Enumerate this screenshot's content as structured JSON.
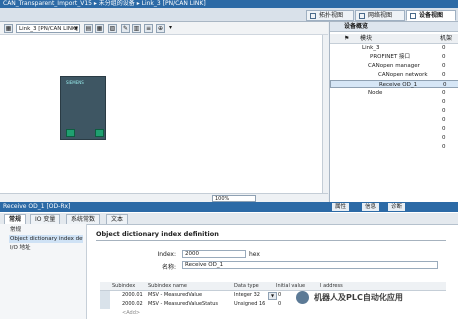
{
  "window": {
    "title": "CAN_Transparent_Import_V15 ▸ 未分组的设备 ▸ Link_3 [PN/CAN LINK]"
  },
  "view_tabs": [
    "拓扑视图",
    "网络视图",
    "设备视图"
  ],
  "toolbar": {
    "device_select": "Link_3 [PN/CAN LINK]"
  },
  "device": {
    "brand": "SIEMENS"
  },
  "zoom": {
    "value": "100%"
  },
  "overview": {
    "title": "设备概览",
    "col_module": "模块",
    "col_rack": "机架",
    "rows": [
      {
        "name": "Link_3",
        "num": "0"
      },
      {
        "name": "PROFINET 接口",
        "num": "0"
      },
      {
        "name": "CANopen manager",
        "num": "0"
      },
      {
        "name": "CANopen network",
        "num": "0"
      },
      {
        "name": "Receive OD_1",
        "num": "0"
      },
      {
        "name": "Node",
        "num": "0"
      },
      {
        "name": "",
        "num": "0"
      },
      {
        "name": "",
        "num": "0"
      },
      {
        "name": "",
        "num": "0"
      },
      {
        "name": "",
        "num": "0"
      },
      {
        "name": "",
        "num": "0"
      },
      {
        "name": "",
        "num": "0"
      }
    ]
  },
  "bottom": {
    "title": "Receive OD_1 [OD-Rx]",
    "right_tabs": [
      "属性",
      "信息",
      "诊断"
    ],
    "tabs": [
      "常规",
      "IO 变量",
      "系统常数",
      "文本"
    ],
    "nav": [
      "常规",
      "Object dictionary index defi...",
      "I/O 地址"
    ],
    "section": "Object dictionary index definition",
    "index_label": "Index:",
    "index_value": "2000",
    "index_unit": "hex",
    "name_label": "名称:",
    "name_value": "Receive OD_1",
    "table_headers": [
      "Subindex",
      "Subindex name",
      "Data type",
      "Initial value",
      "I address"
    ],
    "rows": [
      {
        "sub": "2000.01",
        "name": "MSV - MeasuredValue",
        "type": "Integer 32",
        "init": "0"
      },
      {
        "sub": "2000.02",
        "name": "MSV - MeasuredValueStatus",
        "type": "Unsigned 16",
        "init": "0"
      },
      {
        "sub": "<Add>",
        "name": "",
        "type": "",
        "init": ""
      }
    ]
  },
  "watermark": "机器人及PLC自动化应用"
}
